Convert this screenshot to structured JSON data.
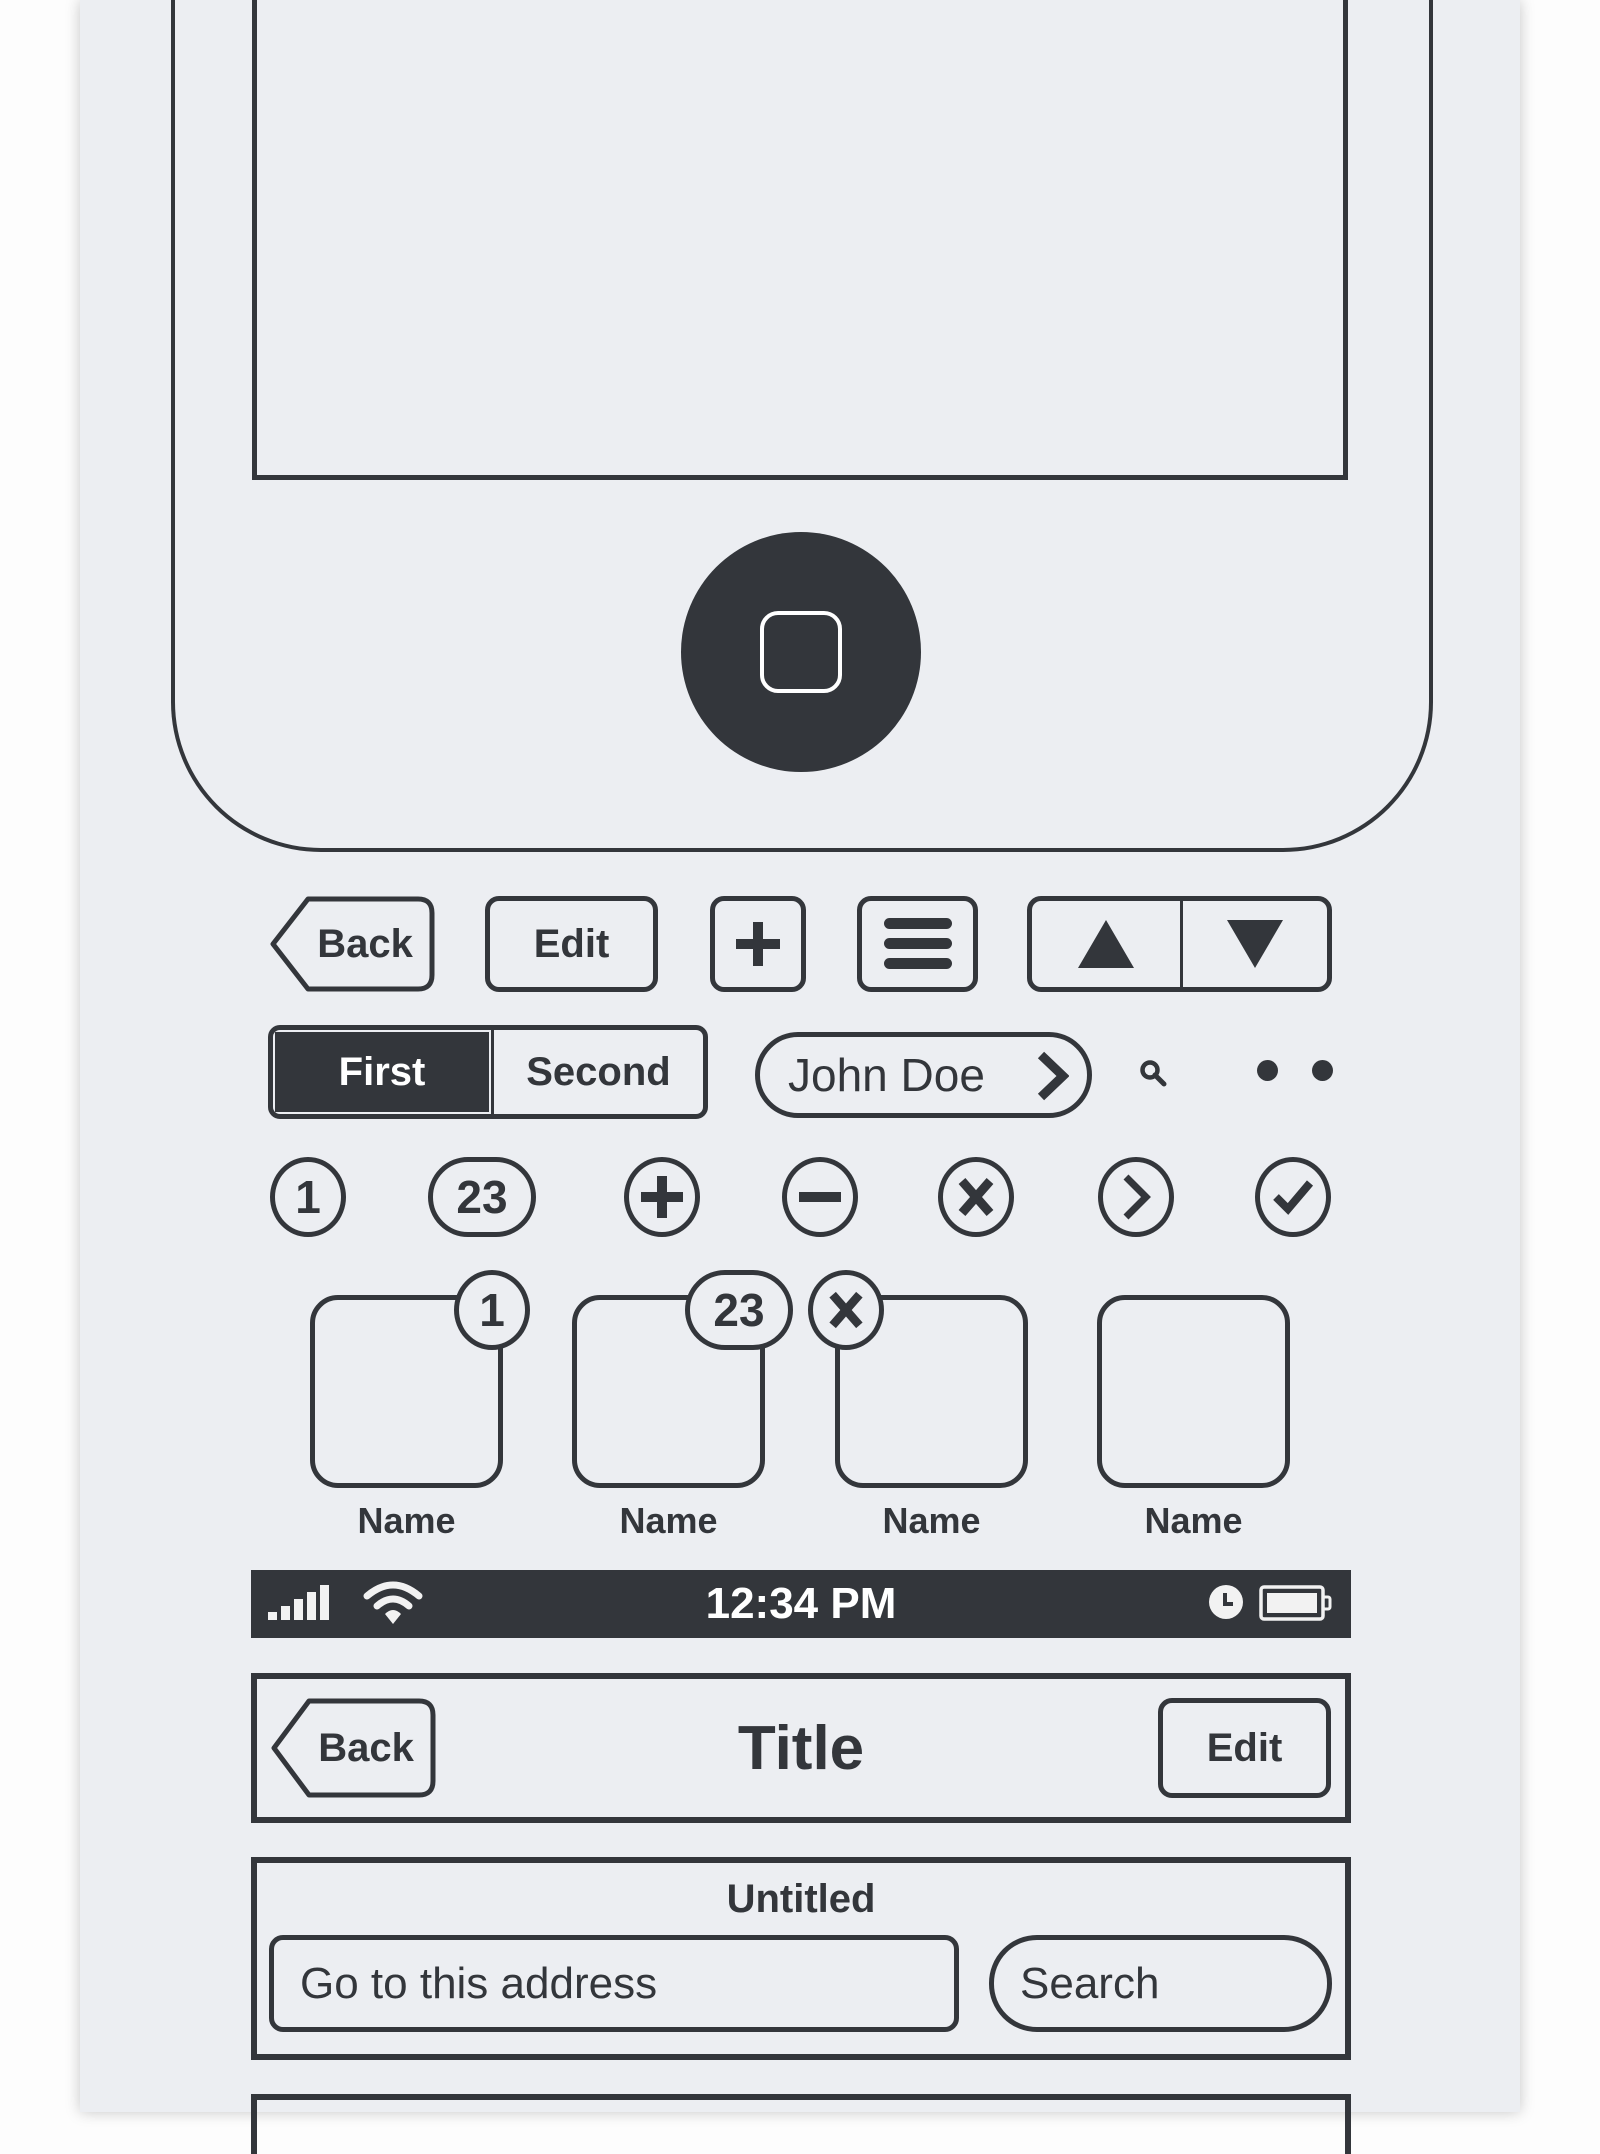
{
  "phone": {
    "home_button_icon": "home-square-icon"
  },
  "toolbar": {
    "back_label": "Back",
    "edit_label": "Edit",
    "add_icon": "plus-icon",
    "menu_icon": "hamburger-icon",
    "up_icon": "triangle-up-icon",
    "down_icon": "triangle-down-icon"
  },
  "segmented": {
    "segments": [
      {
        "label": "First",
        "selected": true
      },
      {
        "label": "Second",
        "selected": false
      }
    ]
  },
  "contact_pill": {
    "label": "John Doe",
    "icon": "chevron-right-icon"
  },
  "page_dots": {
    "count": 2
  },
  "round_icons": [
    {
      "type": "badge",
      "text": "1"
    },
    {
      "type": "badge",
      "text": "23"
    },
    {
      "type": "icon",
      "icon": "plus-circle-icon"
    },
    {
      "type": "icon",
      "icon": "minus-circle-icon"
    },
    {
      "type": "icon",
      "icon": "close-circle-icon"
    },
    {
      "type": "icon",
      "icon": "chevron-circle-icon"
    },
    {
      "type": "icon",
      "icon": "check-circle-icon"
    }
  ],
  "app_icons": [
    {
      "label": "Name",
      "badge": "1"
    },
    {
      "label": "Name",
      "badge": "23"
    },
    {
      "label": "Name",
      "badge": "delete"
    },
    {
      "label": "Name",
      "badge": null
    }
  ],
  "status_bar": {
    "time": "12:34 PM",
    "signal_bars": 5,
    "wifi": true,
    "alarm": true,
    "battery_level": 1.0
  },
  "nav_bar": {
    "back_label": "Back",
    "title": "Title",
    "edit_label": "Edit"
  },
  "browser_bar": {
    "title": "Untitled",
    "address_placeholder": "Go to this address",
    "search_placeholder": "Search"
  }
}
